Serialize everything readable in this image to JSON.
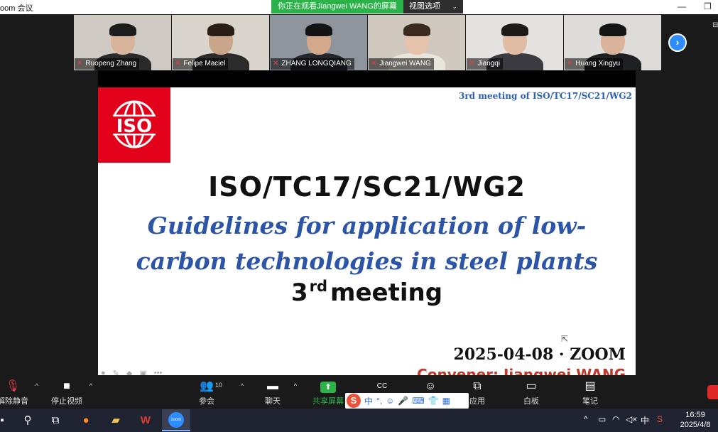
{
  "window": {
    "app_title": "oom 会议",
    "share_banner": "你正在观看Jiangwei  WANG的屏幕",
    "view_options": "视图选项",
    "minimize": "—",
    "restore": "❐"
  },
  "participants": [
    {
      "name": "Ruopeng Zhang",
      "bg": "#cfcac3",
      "skin": "#d8b49a",
      "hair": "#1c1c1c",
      "shirt": "#2a2a2a"
    },
    {
      "name": "Felipe Maciel",
      "bg": "#d9d4cc",
      "skin": "#c9a58a",
      "hair": "#2a1e16",
      "shirt": "#2b2b2b"
    },
    {
      "name": "ZHANG LONGQIANG",
      "bg": "#8f959c",
      "skin": "#d4a88a",
      "hair": "#141414",
      "shirt": "#23262d"
    },
    {
      "name": "Jiangwei WANG",
      "bg": "#cfc9c0",
      "skin": "#e5c3ad",
      "hair": "#3a2a20",
      "shirt": "#e9e4dc"
    },
    {
      "name": "Jiangqi",
      "bg": "#e4e2de",
      "skin": "#e0bca4",
      "hair": "#1e1a18",
      "shirt": "#3a3a40"
    },
    {
      "name": "Huang Xingyu",
      "bg": "#dedcd8",
      "skin": "#d9b39a",
      "hair": "#151515",
      "shirt": "#1f2023"
    }
  ],
  "slide": {
    "meeting_tag": "3rd meeting of ISO/TC17/SC21/WG2",
    "logo_text": "ISO",
    "main_title": "ISO/TC17/SC21/WG2",
    "subtitle_line1": "Guidelines for application of low-",
    "subtitle_line2": "carbon technologies in steel plants",
    "meeting_num": "3",
    "meeting_sup": "rd",
    "meeting_word": "meeting",
    "date": "2025-04-08 · ZOOM",
    "convener": "Convener: Jiangwei WANG",
    "brand_red": "#e3001b",
    "title_blue": "#2c55a8"
  },
  "toolbar": {
    "unmute": "解除静音",
    "stop_video": "停止视频",
    "participants": "参会者",
    "participant_count": "10",
    "chat": "聊天",
    "share_screen": "共享屏幕",
    "apps": "应用",
    "whiteboard": "白板",
    "notes": "笔记"
  },
  "ime": {
    "logo": "S",
    "mode": "中"
  },
  "taskbar": {
    "time": "16:59",
    "date": "2025/4/8",
    "input_lang": "中",
    "zoom_label": "zoom"
  }
}
